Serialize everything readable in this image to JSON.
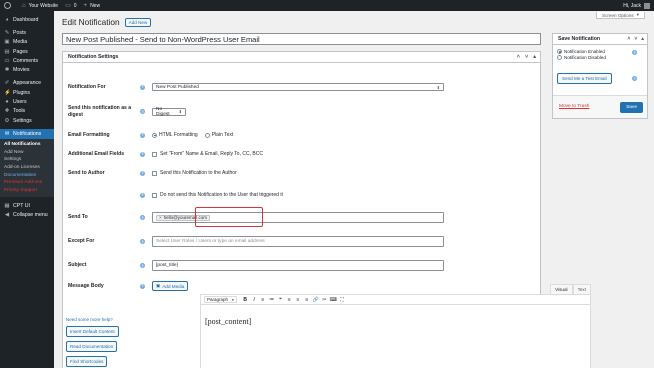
{
  "admin_bar": {
    "site_name": "Your Website",
    "comments_count": "0",
    "new_label": "New",
    "greeting": "Hi, Jack"
  },
  "sidebar": {
    "items": [
      {
        "label": "Dashboard",
        "icon": "dashboard-icon"
      },
      {
        "label": "Posts",
        "icon": "pin-icon"
      },
      {
        "label": "Media",
        "icon": "media-icon"
      },
      {
        "label": "Pages",
        "icon": "page-icon"
      },
      {
        "label": "Comments",
        "icon": "comment-icon"
      },
      {
        "label": "Movies",
        "icon": "movie-icon"
      },
      {
        "label": "Appearance",
        "icon": "brush-icon"
      },
      {
        "label": "Plugins",
        "icon": "plugin-icon"
      },
      {
        "label": "Users",
        "icon": "user-icon"
      },
      {
        "label": "Tools",
        "icon": "wrench-icon"
      },
      {
        "label": "Settings",
        "icon": "settings-icon"
      },
      {
        "label": "Notifications",
        "icon": "bell-icon"
      },
      {
        "label": "CPT UI",
        "icon": "cpt-icon"
      },
      {
        "label": "Collapse menu",
        "icon": "collapse-icon"
      }
    ],
    "submenu": [
      "All Notifications",
      "Add New",
      "Settings",
      "Add-on Licenses",
      "Documentation",
      "Premium Add-ons",
      "Priority Support"
    ]
  },
  "header": {
    "screen_options": "Screen Options",
    "title": "Edit Notification",
    "add_new": "Add New"
  },
  "post_title": "New Post Published - Send to Non-WordPress User Email",
  "settings": {
    "heading": "Notification Settings",
    "notification_for_label": "Notification For",
    "notification_for_value": "New Post Published",
    "digest_label": "Send this notification as a digest",
    "digest_value": "No Digest",
    "formatting_label": "Email Formatting",
    "formatting_html": "HTML Formatting",
    "formatting_plain": "Plain Text",
    "additional_label": "Additional Email Fields",
    "additional_check": "Set \"From\" Name & Email, Reply To, CC, BCC",
    "author_label": "Send to Author",
    "author_check": "Send this Notification to the Author",
    "not_trigger_check": "Do not send this Notification to the User that triggered it",
    "send_to_label": "Send To",
    "send_to_tag": "hello@youremail.com",
    "except_label": "Except For",
    "except_placeholder": "Select User Roles / Users or type an email address",
    "subject_label": "Subject",
    "subject_value": "[post_title]",
    "body_label": "Message Body",
    "add_media": "Add Media",
    "tab_visual": "Visual",
    "tab_text": "Text",
    "format_select": "Paragraph",
    "toolbar": [
      "B",
      "I",
      "≡",
      "≔",
      "❝",
      "≡",
      "≡",
      "≡",
      "🔗",
      "✂",
      "⌨",
      "⛶"
    ],
    "body_content": "[post_content]"
  },
  "help": {
    "need_help": "Need some more help?",
    "insert_default": "Insert Default Content",
    "read_docs": "Read Documentation",
    "find_shortcodes": "Find Shortcodes"
  },
  "save_box": {
    "heading": "Save Notification",
    "enabled": "Notification Enabled",
    "disabled": "Notification Disabled",
    "test_email": "Send Me a Test Email",
    "trash": "Move to Trash",
    "save": "Save"
  },
  "colors": {
    "accent": "#2271b1",
    "admin_dark": "#1d2327",
    "highlight_border": "#d63638"
  }
}
